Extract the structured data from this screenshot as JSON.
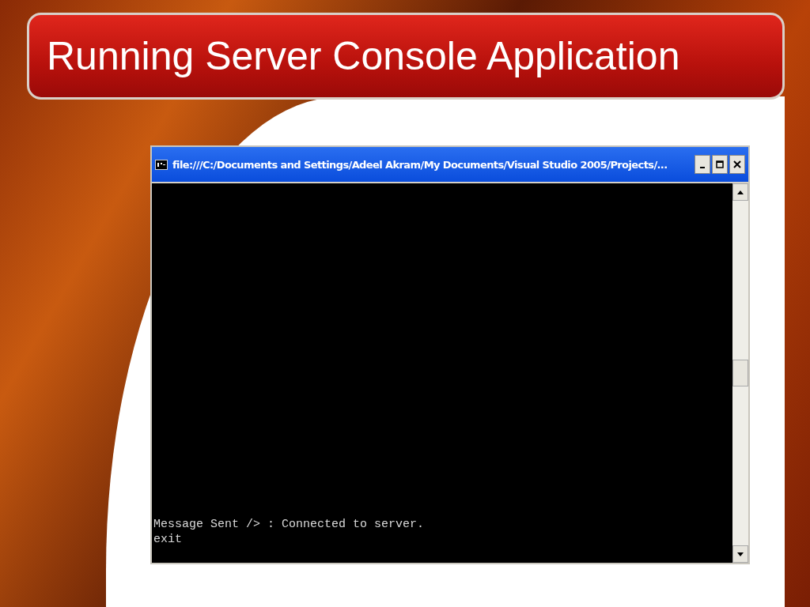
{
  "slide": {
    "title": "Running Server Console Application"
  },
  "console_window": {
    "title": "file:///C:/Documents and Settings/Adeel Akram/My Documents/Visual Studio 2005/Projects/...",
    "output_lines": [
      "Message Sent /> : Connected to server.",
      "exit"
    ]
  }
}
